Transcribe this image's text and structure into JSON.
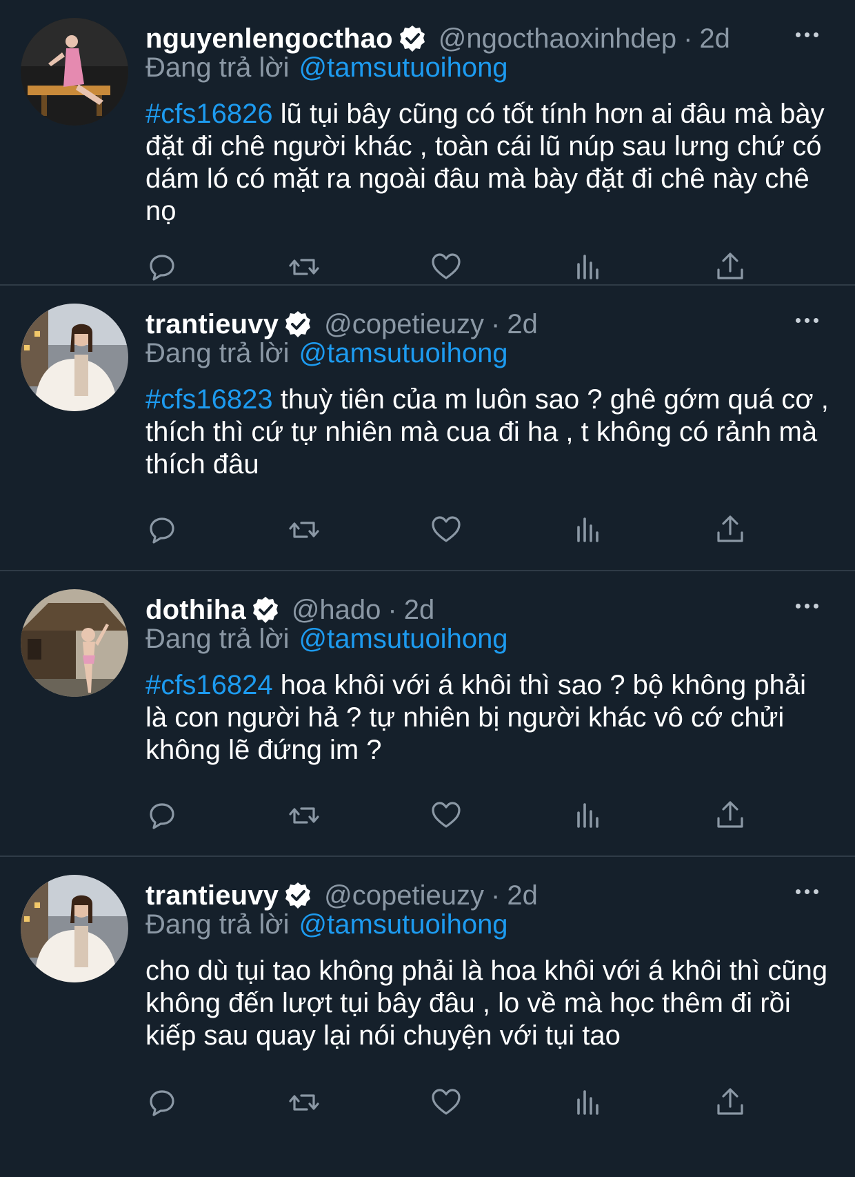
{
  "reply_prefix": "Đang trả lời",
  "colors": {
    "background": "#15202b",
    "muted": "#8b98a5",
    "link": "#1d9bf0",
    "divider": "#2f3b47"
  },
  "tweets": [
    {
      "display_name": "nguyenlengocthao",
      "handle": "@ngocthaoxinhdep",
      "time": "2d",
      "reply_to": "@tamsutuoihong",
      "hashtag": "#cfs16826",
      "text": " lũ tụi bây cũng có tốt tính hơn ai đâu mà bày đặt đi chê người khác , toàn cái lũ núp sau lưng chứ có dám ló có mặt ra ngoài đâu mà bày đặt đi chê này chê nọ"
    },
    {
      "display_name": "trantieuvy",
      "handle": "@copetieuzy",
      "time": "2d",
      "reply_to": "@tamsutuoihong",
      "hashtag": "#cfs16823",
      "text": " thuỳ tiên của m luôn sao ? ghê gớm quá cơ , thích thì cứ tự nhiên mà cua đi ha , t không có rảnh mà thích đâu"
    },
    {
      "display_name": "dothiha",
      "handle": "@hado",
      "time": "2d",
      "reply_to": "@tamsutuoihong",
      "hashtag": "#cfs16824",
      "text": " hoa khôi với á khôi thì sao ? bộ không phải là con người hả ? tự nhiên bị người khác vô cớ chửi không lẽ đứng im ?"
    },
    {
      "display_name": "trantieuvy",
      "handle": "@copetieuzy",
      "time": "2d",
      "reply_to": "@tamsutuoihong",
      "hashtag": "",
      "text": "cho dù tụi tao không phải là hoa khôi với á khôi thì cũng không đến lượt tụi bây đâu , lo về mà học thêm đi rồi kiếp sau quay lại nói chuyện với tụi tao"
    }
  ],
  "icons": [
    "reply-icon",
    "retweet-icon",
    "like-icon",
    "views-icon",
    "share-icon",
    "more-icon",
    "verified-icon"
  ]
}
